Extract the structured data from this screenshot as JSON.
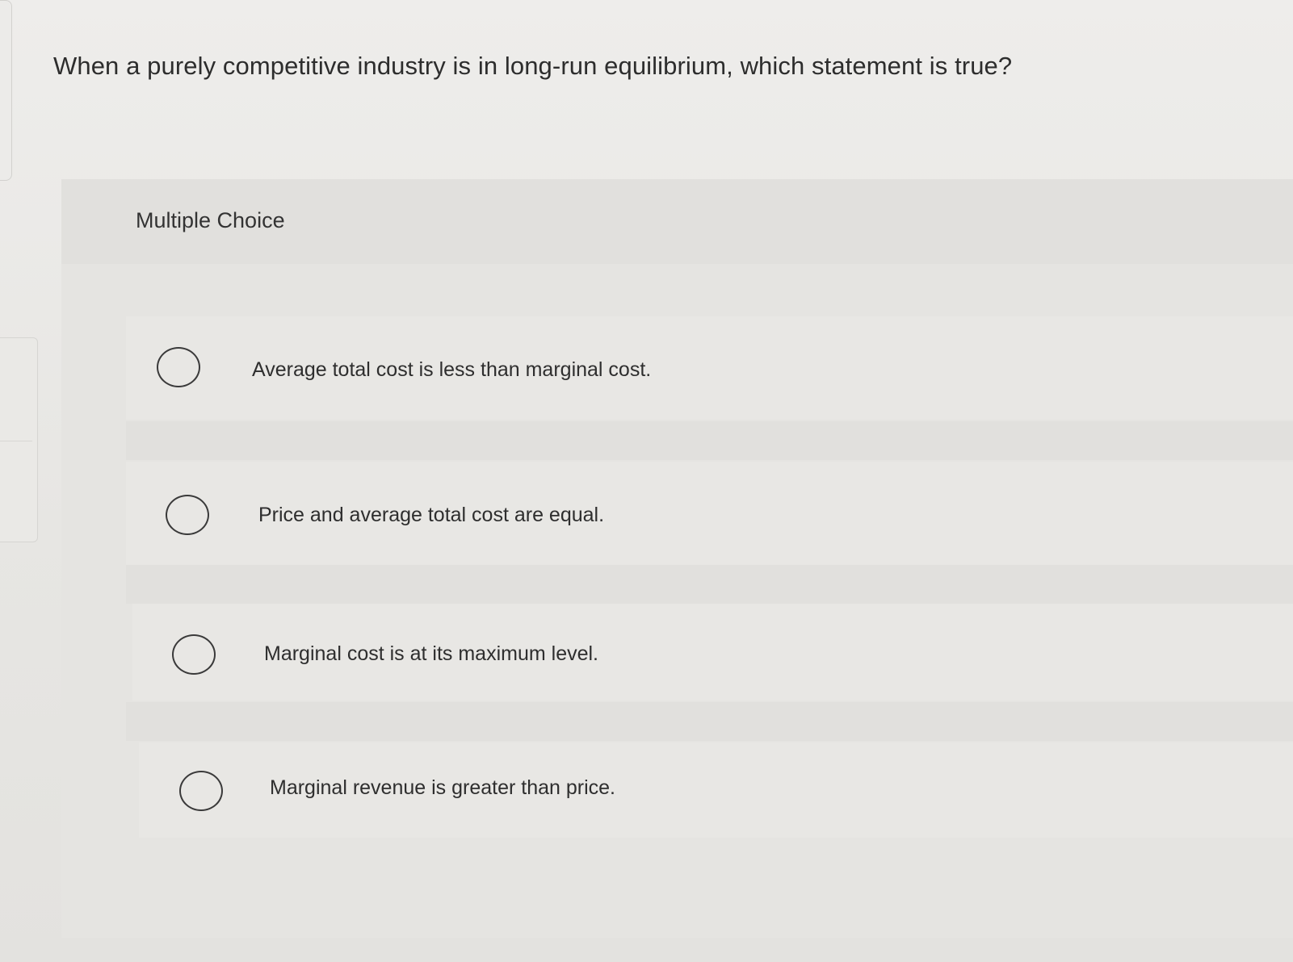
{
  "question": {
    "text": "When a purely competitive industry is in long-run equilibrium, which statement is true?"
  },
  "card": {
    "header_label": "Multiple Choice"
  },
  "options": [
    {
      "label": "Average total cost is less than marginal cost."
    },
    {
      "label": "Price and average total cost are equal."
    },
    {
      "label": "Marginal cost is at its maximum level."
    },
    {
      "label": "Marginal revenue is greater than price."
    }
  ]
}
